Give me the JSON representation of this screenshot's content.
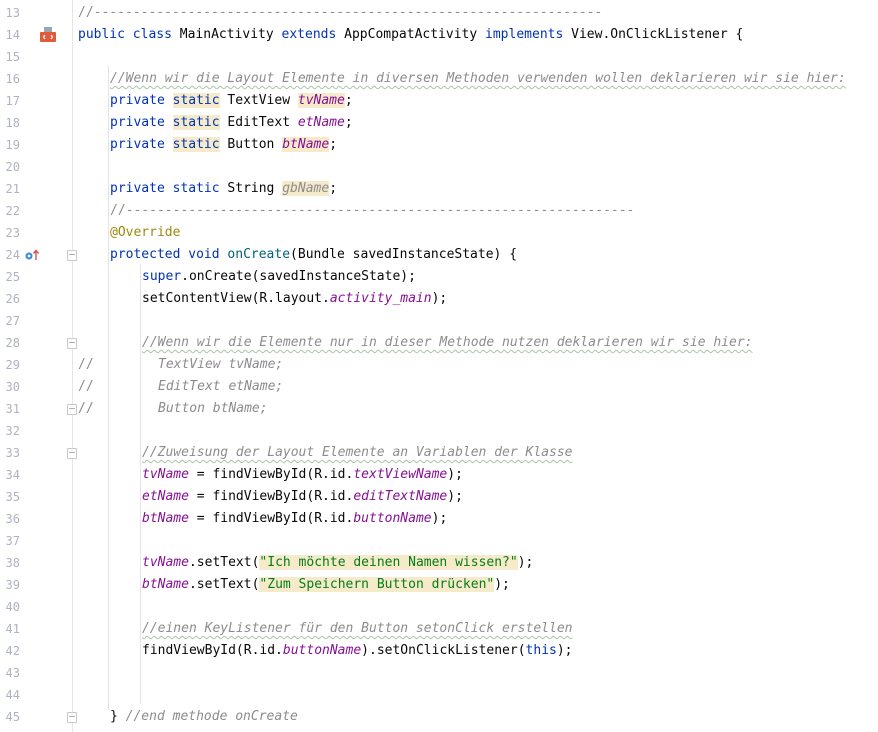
{
  "editor": {
    "lines": [
      {
        "n": "13",
        "t": "//-----------------------------------------------------------------"
      },
      {
        "n": "14",
        "a": "public",
        "b": "class",
        "c": "MainActivity",
        "d": "extends",
        "e": "AppCompatActivity",
        "f": "implements",
        "g": "View.OnClickListener {"
      },
      {
        "n": "15"
      },
      {
        "n": "16",
        "t": "//Wenn wir die Layout Elemente in diversen Methoden verwenden wollen deklarieren wir sie hier:"
      },
      {
        "n": "17",
        "a": "private",
        "b": "static",
        "c": "TextView",
        "d": "tvName",
        "e": ";"
      },
      {
        "n": "18",
        "a": "private",
        "b": "static",
        "c": "EditText",
        "d": "etName",
        "e": ";"
      },
      {
        "n": "19",
        "a": "private",
        "b": "static",
        "c": "Button",
        "d": "btName",
        "e": ";"
      },
      {
        "n": "20"
      },
      {
        "n": "21",
        "a": "private",
        "b": "static",
        "c": "String",
        "d": "gbName",
        "e": ";"
      },
      {
        "n": "22",
        "t": "//-----------------------------------------------------------------"
      },
      {
        "n": "23",
        "t": "@Override"
      },
      {
        "n": "24",
        "a": "protected",
        "b": "void",
        "c": "onCreate",
        "d": "(Bundle savedInstanceState) {"
      },
      {
        "n": "25",
        "a": "super",
        "b": ".onCreate(savedInstanceState);"
      },
      {
        "n": "26",
        "a": "setContentView(R.layout.",
        "b": "activity_main",
        "c": ");"
      },
      {
        "n": "27"
      },
      {
        "n": "28",
        "t": "//Wenn wir die Elemente nur in dieser Methode nutzen deklarieren wir sie hier:"
      },
      {
        "n": "29",
        "a": "//",
        "b": "TextView tvName;"
      },
      {
        "n": "30",
        "a": "//",
        "b": "EditText etName;"
      },
      {
        "n": "31",
        "a": "//",
        "b": "Button btName;"
      },
      {
        "n": "32"
      },
      {
        "n": "33",
        "t": "//Zuweisung der Layout Elemente an Variablen der Klasse"
      },
      {
        "n": "34",
        "a": "tvName",
        "b": " = findViewById(R.id.",
        "c": "textViewName",
        "d": ");"
      },
      {
        "n": "35",
        "a": "etName",
        "b": " = findViewById(R.id.",
        "c": "editTextName",
        "d": ");"
      },
      {
        "n": "36",
        "a": "btName",
        "b": " = findViewById(R.id.",
        "c": "buttonName",
        "d": ");"
      },
      {
        "n": "37"
      },
      {
        "n": "38",
        "a": "tvName",
        "b": ".setText(",
        "c": "\"Ich möchte deinen Namen wissen?\"",
        "d": ");"
      },
      {
        "n": "39",
        "a": "btName",
        "b": ".setText(",
        "c": "\"Zum Speichern Button drücken\"",
        "d": ");"
      },
      {
        "n": "40"
      },
      {
        "n": "41",
        "t": "//einen KeyListener für den Button setonClick erstellen"
      },
      {
        "n": "42",
        "a": "findViewById(R.id.",
        "b": "buttonName",
        "c": ").setOnClickListener(",
        "d": "this",
        "e": ");"
      },
      {
        "n": "43"
      },
      {
        "n": "44"
      },
      {
        "n": "45",
        "a": "}",
        "b": "//end methode onCreate"
      }
    ]
  },
  "gutter_icons": {
    "line14": "run-class-icon",
    "line24": "override-method-icon"
  }
}
